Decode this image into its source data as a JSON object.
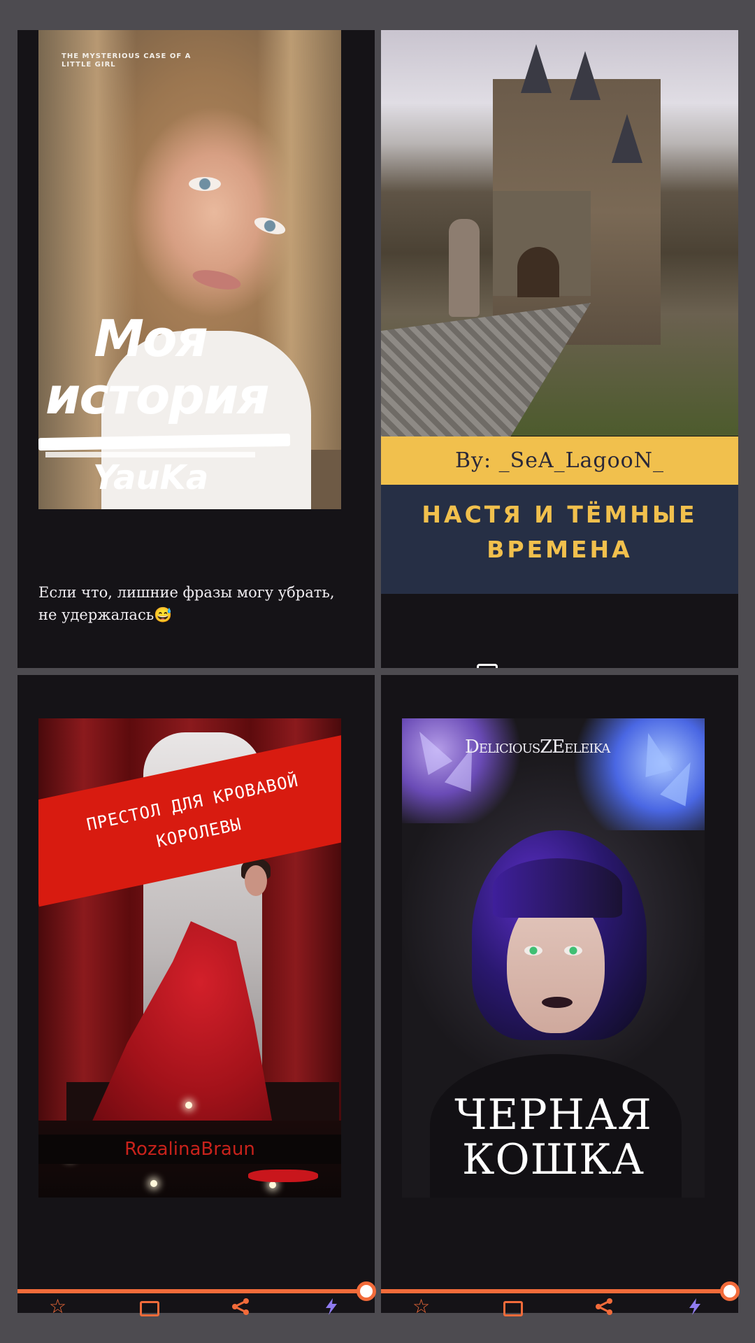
{
  "covers": {
    "card1": {
      "tagline": "THE MYSTERIOUS CASE OF A LITTLE GIRL",
      "title": "Моя история",
      "author": "YauKa",
      "note": "Если что, лишние фразы могу убрать, не удержалась😅"
    },
    "card2": {
      "byline": "By: _SeA_LagooN_",
      "title": "НАСТЯ И ТЁМНЫЕ ВРЕМЕНА"
    },
    "card3": {
      "title": "ПРЕСТОЛ ДЛЯ КРОВАВОЙ КОРОЛЕВЫ",
      "author": "RozalinaBraun"
    },
    "card4": {
      "author": "DeliciousZEeleika",
      "title": "ЧЕРНАЯ КОШКА"
    }
  },
  "toolbar": {
    "icons": [
      "star-icon",
      "comment-icon",
      "share-icon",
      "boost-icon"
    ],
    "accent_color": "#f26b3a",
    "boost_color": "#8f7bf0"
  },
  "theme": {
    "background": "#4d4b50",
    "card_background": "#151317"
  }
}
